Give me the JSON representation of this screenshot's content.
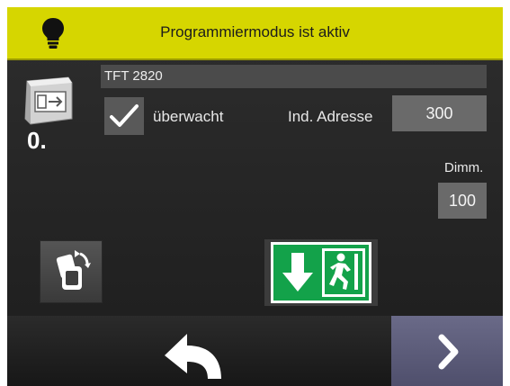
{
  "header": {
    "title": "Programmiermodus ist aktiv",
    "icon": "lightbulb-icon",
    "color": "#d6d600"
  },
  "device": {
    "number": "0.",
    "name": "TFT 2820",
    "icon": "exit-luminaire-icon"
  },
  "monitored": {
    "label": "überwacht",
    "checked": true
  },
  "address": {
    "label": "Ind. Adresse",
    "value": "300"
  },
  "dimm": {
    "label": "Dimm.",
    "value": "100"
  },
  "actions": {
    "rotate_icon": "rotate-device-icon",
    "sign_icon": "exit-sign-down-icon",
    "sign_color": "#13a24a"
  },
  "footer": {
    "back_icon": "back-arrow-icon",
    "next_icon": "chevron-right-icon",
    "next_color": "#5c5c7a"
  }
}
